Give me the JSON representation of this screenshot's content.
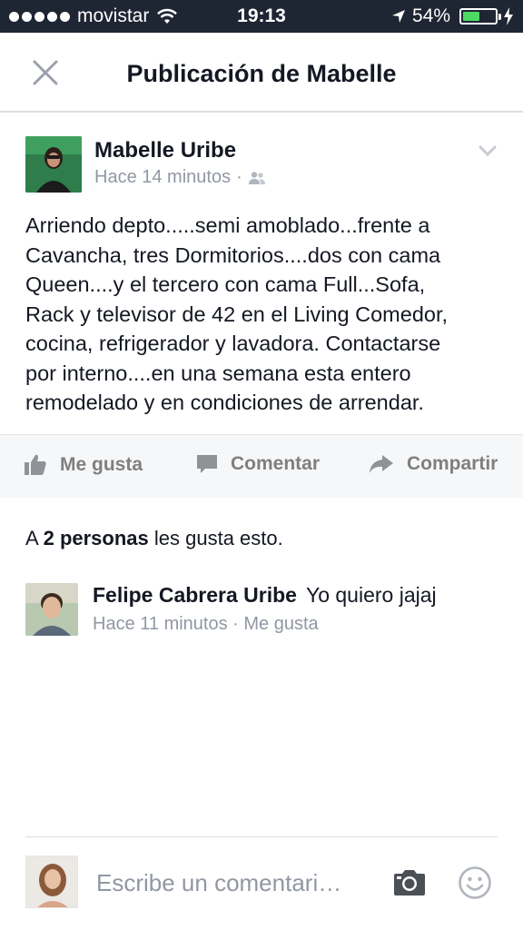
{
  "status_bar": {
    "carrier": "movistar",
    "time": "19:13",
    "battery_percent": "54%",
    "battery_level": 0.54,
    "battery_color": "#4cd964"
  },
  "header": {
    "title": "Publicación de Mabelle",
    "close_icon": "close-icon"
  },
  "post": {
    "author": "Mabelle Uribe",
    "timestamp": "Hace 14 minutos",
    "separator": "·",
    "audience_icon": "friends-icon",
    "body": "Arriendo depto.....semi amoblado...frente a\nCavancha, tres Dormitorios....dos con cama\nQueen....y el tercero con cama Full...Sofa,\nRack y televisor de 42 en el Living Comedor,\ncocina, refrigerador y lavadora.  Contactarse\npor interno....en una semana esta entero\nremodelado y en condiciones de arrendar."
  },
  "actions": {
    "like": "Me gusta",
    "comment": "Comentar",
    "share": "Compartir"
  },
  "likes": {
    "prefix": "A",
    "count_text": "2 personas",
    "suffix": "les gusta esto."
  },
  "comments": [
    {
      "author": "Felipe Cabrera Uribe",
      "text": "Yo quiero jajaj",
      "timestamp": "Hace 11 minutos",
      "separator": "·",
      "like_label": "Me gusta"
    }
  ],
  "composer": {
    "placeholder": "Escribe un comentari…",
    "camera_icon": "camera-icon",
    "emoji_icon": "emoji-icon"
  },
  "colors": {
    "status_bar_bg": "#1e2533",
    "action_bar_bg": "#f6f7f8",
    "meta_text": "#9197a3",
    "action_text": "#7f7f7f"
  }
}
